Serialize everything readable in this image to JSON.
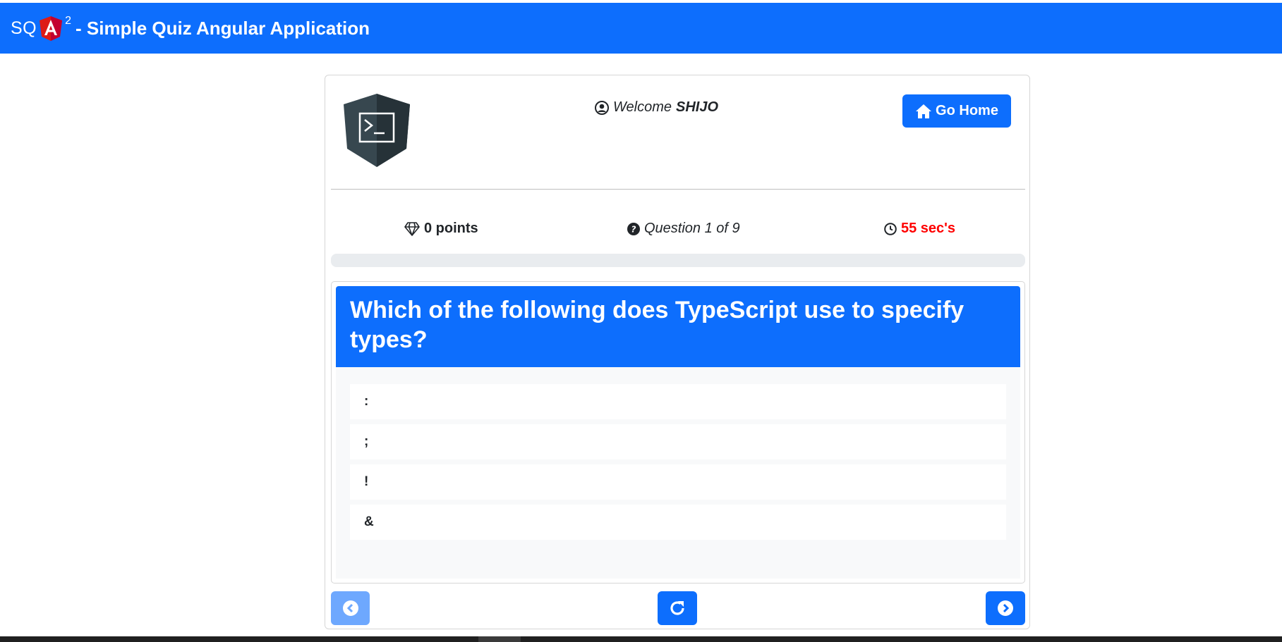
{
  "header": {
    "brand_prefix": "SQ",
    "brand_superscript": "2",
    "brand_title": "- Simple Quiz Angular Application",
    "logo_icon": "angular-shield-icon"
  },
  "user": {
    "welcome_label": "Welcome",
    "name": "SHIJO"
  },
  "actions": {
    "go_home_label": "Go Home"
  },
  "stats": {
    "points": "0 points",
    "question": "Question 1 of 9",
    "timer": "55 sec's"
  },
  "progress": {
    "fraction": 0.0
  },
  "question": {
    "text": "Which of the following does TypeScript use to specify types?",
    "options": [
      ":",
      ";",
      "!",
      "&"
    ]
  },
  "colors": {
    "primary": "#0d6efd",
    "primary_disabled": "#6ea8fe",
    "timer": "#ff0000",
    "option_area": "#f8f9fa"
  }
}
